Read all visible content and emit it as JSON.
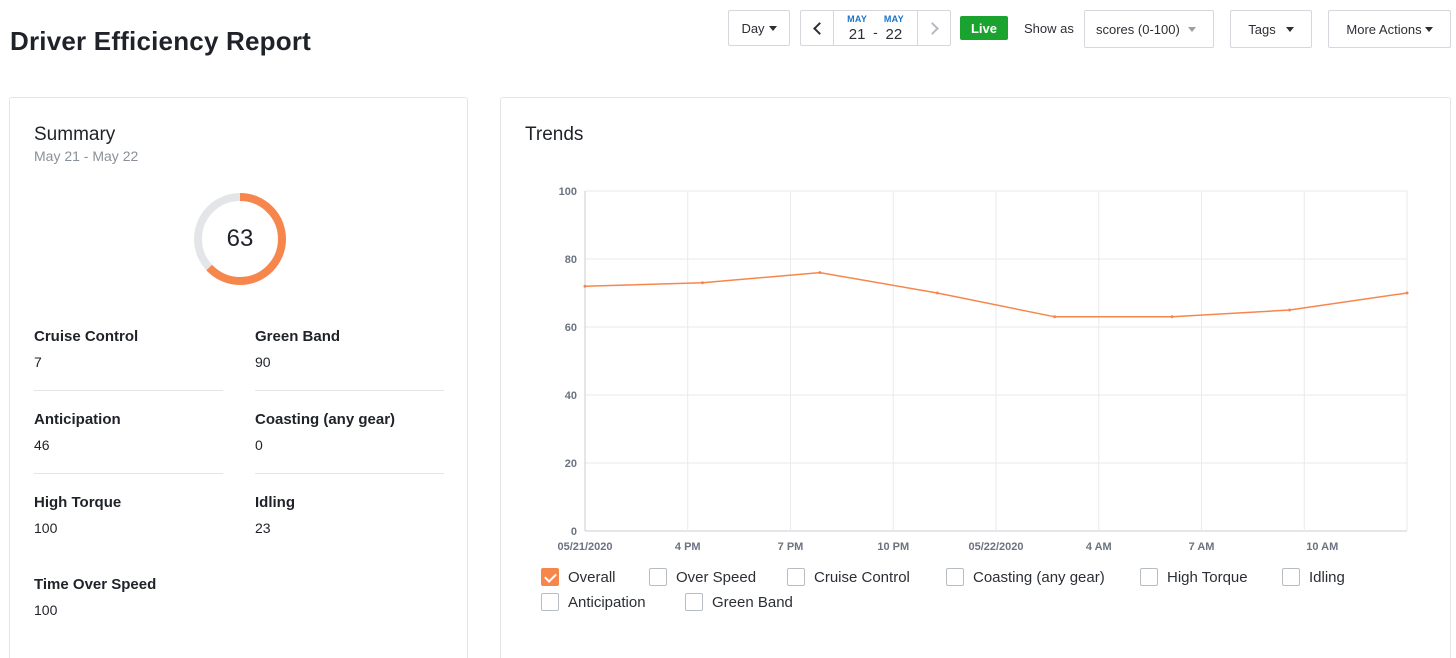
{
  "page": {
    "title": "Driver Efficiency Report"
  },
  "toolbar": {
    "period_label": "Day",
    "date_range": {
      "start_month": "MAY",
      "start_day": "21",
      "separator": "-",
      "end_month": "MAY",
      "end_day": "22"
    },
    "live_label": "Live",
    "show_as_label": "Show as",
    "show_as_value": "scores (0-100)",
    "tags_label": "Tags",
    "more_actions_label": "More Actions"
  },
  "summary": {
    "title": "Summary",
    "subtitle": "May 21 - May 22",
    "overall_score": 63,
    "overall_score_text": "63",
    "metrics": [
      {
        "label": "Cruise Control",
        "value": "7"
      },
      {
        "label": "Green Band",
        "value": "90"
      },
      {
        "label": "Anticipation",
        "value": "46"
      },
      {
        "label": "Coasting (any gear)",
        "value": "0"
      },
      {
        "label": "High Torque",
        "value": "100"
      },
      {
        "label": "Idling",
        "value": "23"
      },
      {
        "label": "Time Over Speed",
        "value": "100"
      }
    ]
  },
  "trends": {
    "title": "Trends",
    "legend": [
      {
        "label": "Overall",
        "checked": true
      },
      {
        "label": "Over Speed",
        "checked": false
      },
      {
        "label": "Cruise Control",
        "checked": false
      },
      {
        "label": "Coasting (any gear)",
        "checked": false
      },
      {
        "label": "High Torque",
        "checked": false
      },
      {
        "label": "Idling",
        "checked": false
      },
      {
        "label": "Anticipation",
        "checked": false
      },
      {
        "label": "Green Band",
        "checked": false
      }
    ]
  },
  "colors": {
    "accent": "#f7864c",
    "donut_track": "#e3e5e8",
    "live": "#1aa32f",
    "date_month": "#1a73c8",
    "grid": "#e8eaed"
  },
  "chart_data": {
    "type": "line",
    "title": "Trends",
    "xlabel": "",
    "ylabel": "",
    "categories": [
      "05/21/2020",
      "4 PM",
      "7 PM",
      "10 PM",
      "05/22/2020",
      "4 AM",
      "7 AM",
      "10 AM"
    ],
    "yticks": [
      0,
      20,
      40,
      60,
      80,
      100
    ],
    "ylim": [
      0,
      100
    ],
    "x": [
      "05/21/2020 1 PM",
      "05/21/2020 4 PM",
      "05/21/2020 7 PM",
      "05/21/2020 10 PM",
      "05/22/2020 1 AM",
      "05/22/2020 4 AM",
      "05/22/2020 7 AM",
      "05/22/2020 10 AM",
      "05/22/2020 11 AM"
    ],
    "series": [
      {
        "name": "Overall",
        "values": [
          72,
          73,
          76,
          70,
          63,
          63,
          65,
          70
        ]
      }
    ],
    "grid": true,
    "legend_position": "bottom"
  }
}
